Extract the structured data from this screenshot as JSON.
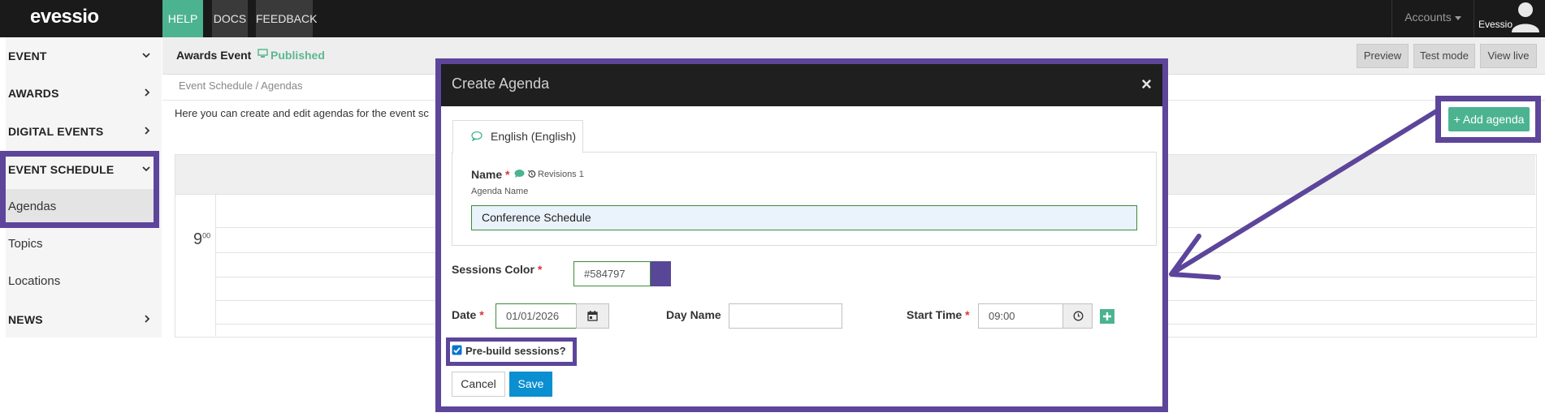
{
  "topbar": {
    "logo": "evessio",
    "nav": [
      {
        "label": "HELP"
      },
      {
        "label": "DOCS"
      },
      {
        "label": "FEEDBACK"
      }
    ],
    "accounts_label": "Accounts",
    "user_name": "Evessio"
  },
  "sidebar": {
    "sections": [
      {
        "label": "EVENT"
      },
      {
        "label": "AWARDS"
      },
      {
        "label": "DIGITAL EVENTS"
      },
      {
        "label": "EVENT SCHEDULE"
      },
      {
        "label": "NEWS"
      }
    ],
    "sub_items": [
      {
        "label": "Agendas"
      },
      {
        "label": "Topics"
      },
      {
        "label": "Locations"
      }
    ]
  },
  "header": {
    "event_title": "Awards Event",
    "status": "Published",
    "buttons": [
      {
        "label": "Preview"
      },
      {
        "label": "Test mode"
      },
      {
        "label": "View live"
      }
    ]
  },
  "main": {
    "breadcrumb": "Event Schedule / Agendas",
    "intro": "Here you can create and edit agendas for the event sc",
    "add_button": "+ Add agenda",
    "hour_main": "9",
    "hour_sup": "00"
  },
  "modal": {
    "title": "Create Agenda",
    "close": "×",
    "tab_label": "English (English)",
    "name_label": "Name",
    "required_mark": "*",
    "revisions": "Revisions 1",
    "agenda_name_hint": "Agenda Name",
    "name_value": "Conference Schedule",
    "sessions_color_label": "Sessions Color",
    "sessions_color_value": "#584797",
    "date_label": "Date",
    "date_value": "01/01/2026",
    "day_name_label": "Day Name",
    "day_name_value": "",
    "start_time_label": "Start Time",
    "start_time_value": "09:00",
    "prebuild_label": "Pre-build sessions?",
    "prebuild_checked": true,
    "cancel": "Cancel",
    "save": "Save"
  },
  "colors": {
    "accent_green": "#4cb391",
    "annotation_purple": "#5c459a",
    "save_blue": "#0a8fd0",
    "session_swatch": "#584797"
  },
  "icons": [
    "user-icon",
    "chevron-down-icon",
    "chevron-right-icon",
    "comment-icon",
    "history-icon",
    "calendar-icon",
    "clock-icon",
    "plus-icon",
    "close-icon",
    "monitor-icon",
    "arrow-annotation"
  ]
}
